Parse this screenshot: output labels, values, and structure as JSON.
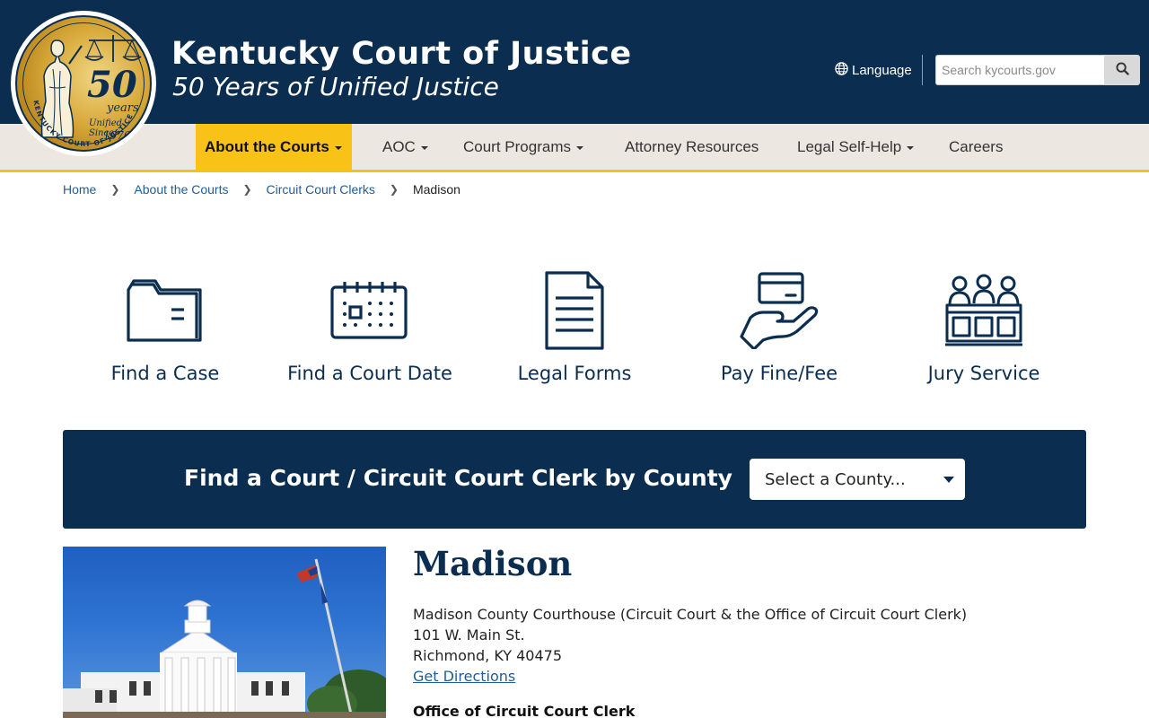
{
  "header": {
    "title": "Kentucky Court of Justice",
    "subtitle": "50 Years of Unified Justice",
    "seal": {
      "number": "50",
      "years": "years",
      "since": "Unified Since",
      "year": "1976",
      "ring_text": "KENTUCKY COURT OF JUSTICE"
    },
    "language_label": "Language",
    "search_placeholder": "Search kycourts.gov"
  },
  "nav": {
    "items": [
      {
        "label": "About the Courts",
        "dropdown": true,
        "active": true
      },
      {
        "label": "AOC",
        "dropdown": true
      },
      {
        "label": "Court Programs",
        "dropdown": true
      },
      {
        "label": "Attorney Resources",
        "dropdown": false
      },
      {
        "label": "Legal Self-Help",
        "dropdown": true
      },
      {
        "label": "Careers",
        "dropdown": false
      }
    ]
  },
  "breadcrumb": {
    "items": [
      "Home",
      "About the Courts",
      "Circuit Court Clerks"
    ],
    "current": "Madison"
  },
  "quick_links": [
    {
      "label": "Find a Case",
      "icon": "folder-icon"
    },
    {
      "label": "Find a Court Date",
      "icon": "calendar-icon"
    },
    {
      "label": "Legal Forms",
      "icon": "document-icon"
    },
    {
      "label": "Pay Fine/Fee",
      "icon": "hand-card-icon"
    },
    {
      "label": "Jury Service",
      "icon": "jury-box-icon"
    }
  ],
  "county_finder": {
    "heading": "Find a Court / Circuit Court Clerk by County",
    "select_placeholder": "Select a County..."
  },
  "court": {
    "name": "Madison",
    "building": "Madison County Courthouse (Circuit Court & the Office of Circuit Court Clerk)",
    "street": "101 W. Main St.",
    "city": "Richmond, KY 40475",
    "directions_label": "Get Directions",
    "clerk_heading": "Office of Circuit Court Clerk"
  },
  "colors": {
    "navy": "#0b2d50",
    "gold": "#f8c217",
    "nav_bg": "#ece8e1",
    "link": "#1f5d99"
  }
}
